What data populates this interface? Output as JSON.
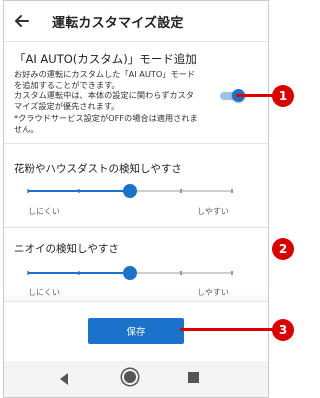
{
  "screen": {
    "title": "運転カスタマイズ設定",
    "back_icon": "arrow-left-icon"
  },
  "ai_auto": {
    "title": "「AI AUTO(カスタム)」モード追加",
    "desc_line1": "お好みの運転にカスタムした「AI AUTO」モード",
    "desc_line2": "を追加することができます。",
    "desc_line3": "カスタム運転中は、本体の設定に関わらずカスタ",
    "desc_line4": "マイズ設定が優先されます。",
    "note_line1": "*クラウドサービス設定がOFFの場合は適用されま",
    "note_line2": "せん。",
    "toggle_on": true
  },
  "sliders": [
    {
      "label": "花粉やハウスダストの検知しやすさ",
      "low_label": "しにくい",
      "high_label": "しやすい",
      "level_fraction": 0.5,
      "steps": 5
    },
    {
      "label": "ニオイの検知しやすさ",
      "low_label": "しにくい",
      "high_label": "しやすい",
      "level_fraction": 0.5,
      "steps": 5
    }
  ],
  "save_label": "保存",
  "callouts": [
    "1",
    "2",
    "3"
  ],
  "colors": {
    "accent": "#1a73c8",
    "callout": "#d90000"
  },
  "navbar_icons": [
    "nav-back-icon",
    "nav-home-icon",
    "nav-recents-icon"
  ]
}
